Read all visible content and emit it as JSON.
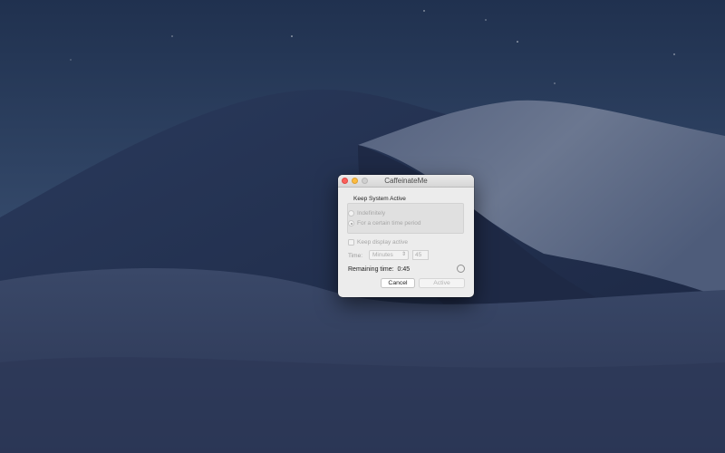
{
  "window": {
    "title": "CaffeinateMe"
  },
  "keep_active": {
    "group_label": "Keep System Active",
    "option_indefinitely": "Indefinitely",
    "option_period": "For a certain time period",
    "selected": "For a certain time period"
  },
  "display": {
    "label": "Keep display active",
    "checked": false
  },
  "time": {
    "label": "Time:",
    "unit_selected": "Minutes",
    "value": "45"
  },
  "remaining": {
    "label": "Remaining time:",
    "value": "0:45"
  },
  "buttons": {
    "cancel": "Cancel",
    "active": "Active"
  },
  "colors": {
    "close": "#fc605b",
    "minimize": "#fdbc40",
    "zoom_disabled": "#d0d0d0",
    "sky_top": "#243656",
    "dune_shadow": "#1b2540"
  },
  "icons": {
    "time_unit_select": "chevron-up-down-icon",
    "progress": "progress-circle-icon"
  }
}
